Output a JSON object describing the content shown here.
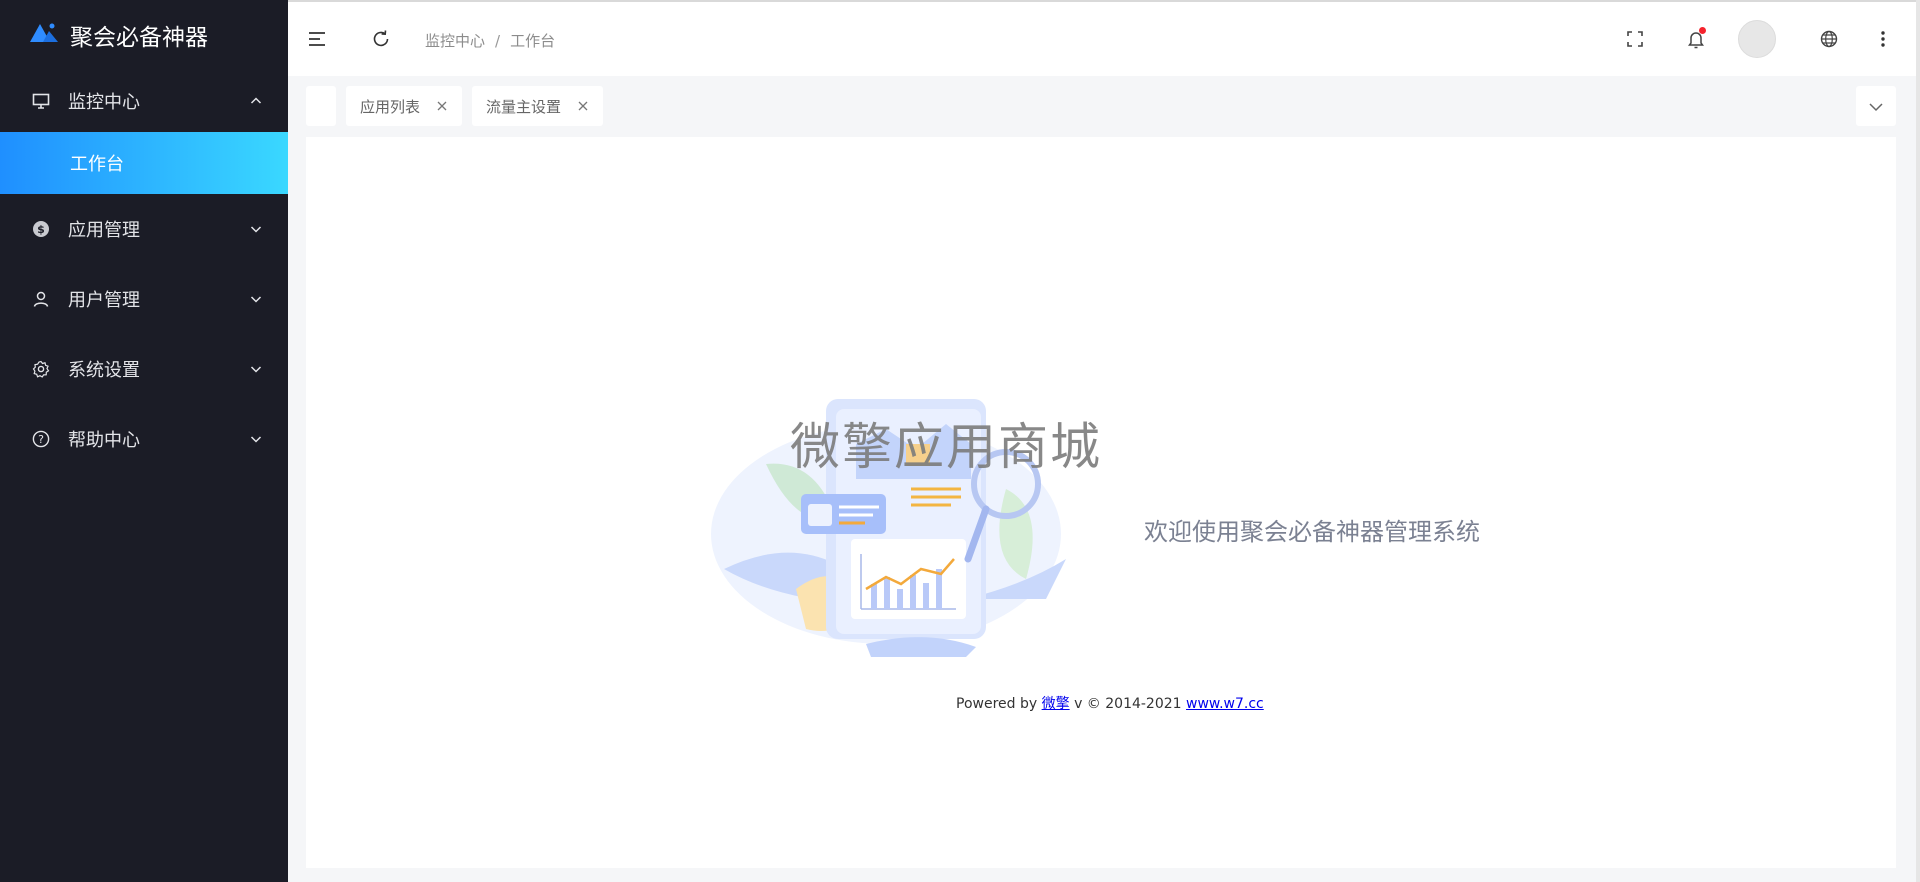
{
  "app": {
    "title": "聚会必备神器"
  },
  "sidebar": {
    "items": [
      {
        "label": "监控中心",
        "icon": "monitor-icon",
        "expanded": true
      },
      {
        "label": "应用管理",
        "icon": "dollar-icon",
        "expanded": false
      },
      {
        "label": "用户管理",
        "icon": "user-icon",
        "expanded": false
      },
      {
        "label": "系统设置",
        "icon": "gear-icon",
        "expanded": false
      },
      {
        "label": "帮助中心",
        "icon": "question-icon",
        "expanded": false
      }
    ],
    "active_sub": {
      "label": "工作台"
    }
  },
  "header": {
    "breadcrumb": [
      "监控中心",
      "工作台"
    ],
    "separator": "/",
    "icons": [
      "menu-fold-icon",
      "refresh-icon",
      "fullscreen-icon",
      "bell-icon",
      "avatar",
      "globe-icon",
      "more-vertical-icon"
    ]
  },
  "tabs": [
    {
      "label": "应用列表"
    },
    {
      "label": "流量主设置"
    }
  ],
  "main": {
    "watermark": "微擎应用商城",
    "welcome": "欢迎使用聚会必备神器管理系统",
    "footer": {
      "prefix": "Powered by",
      "brand": "微擎",
      "version": "v © 2014-2021",
      "link": "www.w7.cc"
    }
  },
  "colors": {
    "sidebar_bg": "#1b1c26",
    "active_gradient_start": "#1f8fff",
    "active_gradient_end": "#3ad8ff",
    "notification_dot": "#f5222d"
  }
}
